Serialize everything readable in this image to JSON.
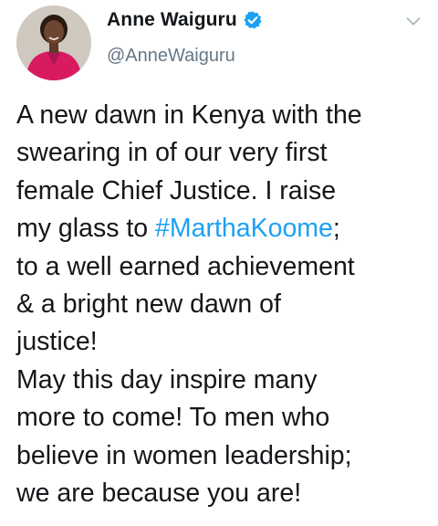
{
  "user": {
    "display_name": "Anne Waiguru",
    "handle": "@AnneWaiguru",
    "avatar_icon": "profile-photo",
    "verified_icon": "verified-badge-icon",
    "verified_color": "#1da1f2"
  },
  "menu": {
    "icon": "chevron-down-icon"
  },
  "tweet": {
    "line1": "A new dawn in Kenya with the",
    "line2": "swearing in of our very first",
    "line3": "female Chief Justice. I raise",
    "line4_before": "my glass to ",
    "hashtag": "#MarthaKoome",
    "line4_after": ";",
    "line5": "to a well earned achievement",
    "line6": "& a bright new dawn of",
    "line7": "justice!",
    "line8": "May this day inspire many",
    "line9": "more to come! To men who",
    "line10": "believe in women leadership;",
    "line11": "we are because you are!"
  },
  "colors": {
    "text": "#14171a",
    "secondary": "#657786",
    "link": "#1da1f2"
  }
}
